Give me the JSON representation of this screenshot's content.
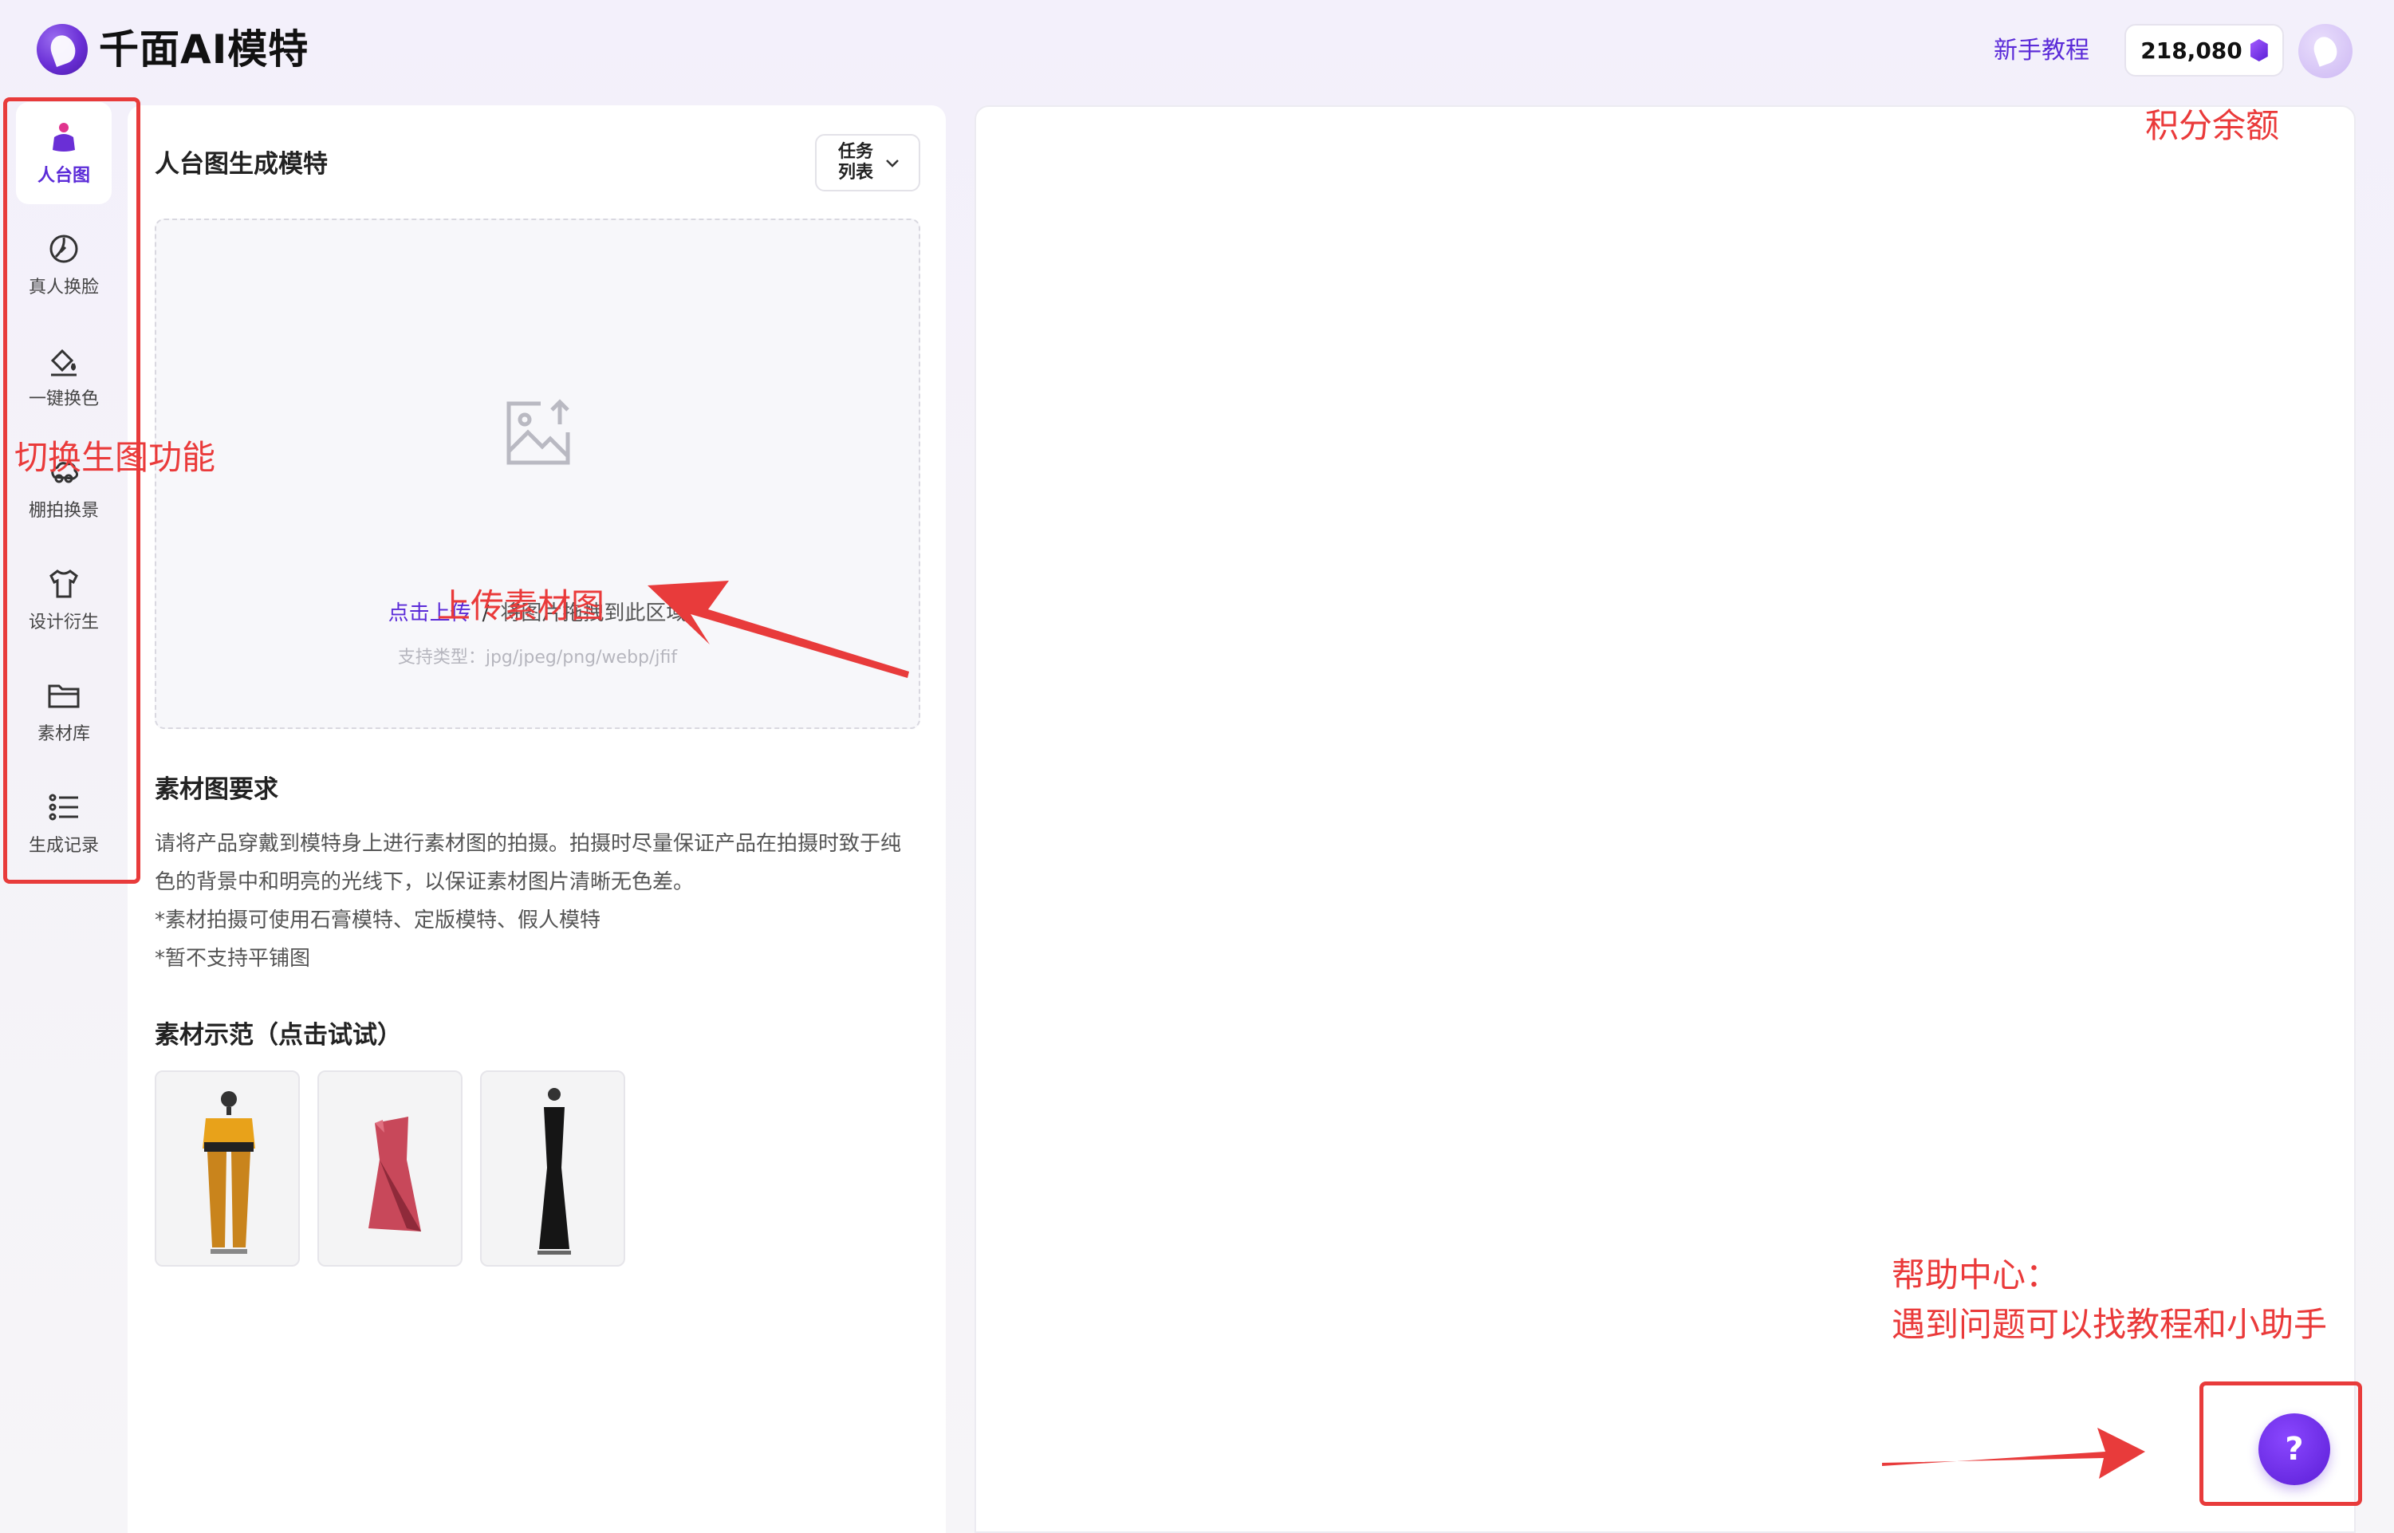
{
  "header": {
    "brand": "千面AI模特",
    "tutorial": "新手教程",
    "credits": "218,080"
  },
  "sidebar": {
    "items": [
      {
        "label": "人台图",
        "icon": "mannequin-icon"
      },
      {
        "label": "真人换脸",
        "icon": "face-swap-icon"
      },
      {
        "label": "一键换色",
        "icon": "paint-bucket-icon"
      },
      {
        "label": "棚拍换景",
        "icon": "scene-change-icon"
      },
      {
        "label": "设计衍生",
        "icon": "shirt-icon"
      },
      {
        "label": "素材库",
        "icon": "folder-icon"
      },
      {
        "label": "生成记录",
        "icon": "list-icon"
      }
    ]
  },
  "panel": {
    "title": "人台图生成模特",
    "task_list": "任务列表",
    "upload": {
      "link": "点击上传",
      "separator": "/",
      "hint": "将图片拖拽到此区域",
      "types": "支持类型：jpg/jpeg/png/webp/jfif"
    },
    "requirements_title": "素材图要求",
    "requirements": [
      "请将产品穿戴到模特身上进行素材图的拍摄。拍摄时尽量保证产品在拍摄时致于纯色的背景中和明亮的光线下，以保证素材图片清晰无色差。",
      "*素材拍摄可使用石膏模特、定版模特、假人模特",
      "*暂不支持平铺图"
    ],
    "demo_title": "素材示范（点击试试）"
  },
  "annotations": {
    "switch_feature": "切换生图功能",
    "upload_material": "上传素材图",
    "credit_balance": "积分余额",
    "help_center_1": "帮助中心：",
    "help_center_2": "遇到问题可以找教程和小助手"
  },
  "help_button": "?",
  "colors": {
    "accent": "#5b2bd8",
    "annotation": "#e83b3b"
  }
}
